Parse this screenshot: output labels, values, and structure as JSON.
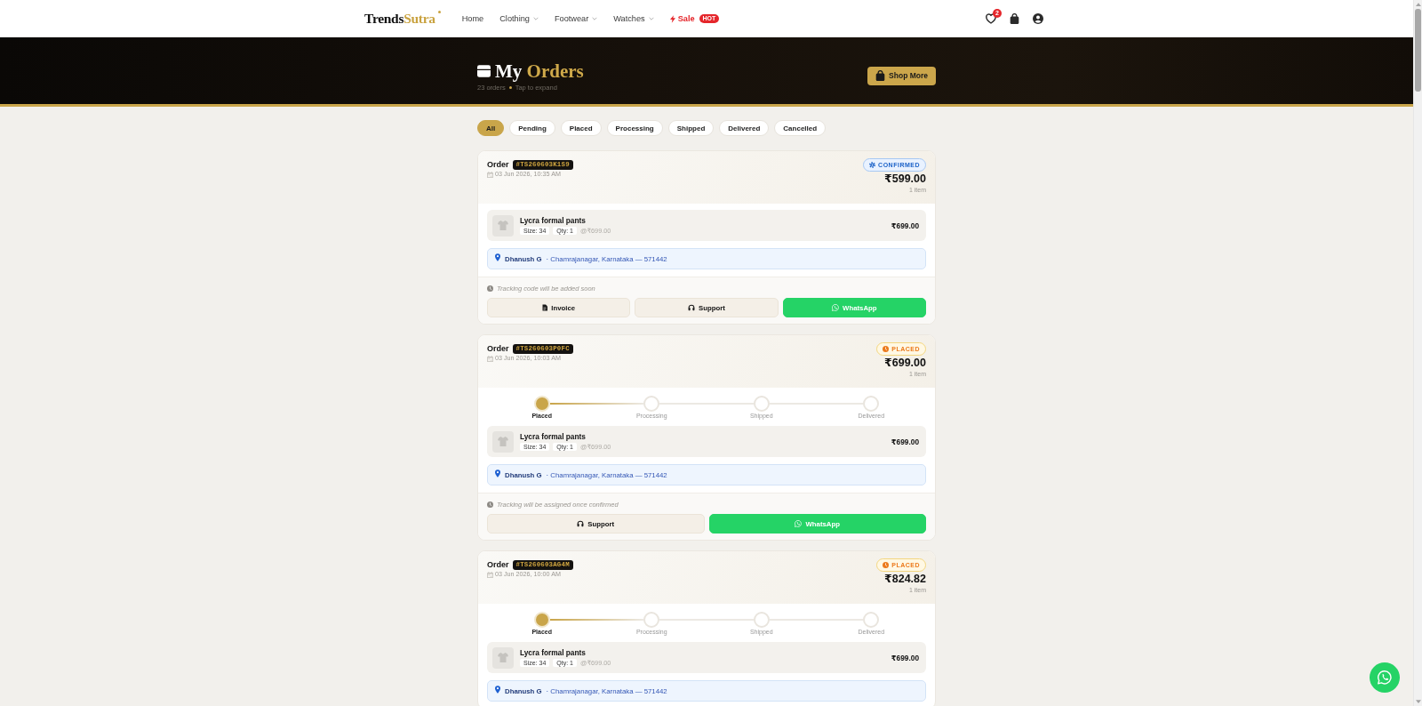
{
  "nav": {
    "brand": {
      "lead": "Trends",
      "accent": "Sutra"
    },
    "links": [
      {
        "label": "Home",
        "kind": "link",
        "dropdown": false
      },
      {
        "label": "Clothing",
        "kind": "link",
        "dropdown": true
      },
      {
        "label": "Footwear",
        "kind": "link",
        "dropdown": true
      },
      {
        "label": "Watches",
        "kind": "link",
        "dropdown": true
      },
      {
        "label": "Sale",
        "kind": "sale",
        "dropdown": false,
        "badge": "HOT"
      }
    ],
    "wishlist_count": "2"
  },
  "header": {
    "title": {
      "lead": "My",
      "accent": "Orders"
    },
    "order_count": "23 orders",
    "hint": "Tap to expand",
    "button": "Shop More"
  },
  "filters": [
    {
      "label": "All",
      "selected": true
    },
    {
      "label": "Pending",
      "selected": false
    },
    {
      "label": "Placed",
      "selected": false
    },
    {
      "label": "Processing",
      "selected": false
    },
    {
      "label": "Shipped",
      "selected": false
    },
    {
      "label": "Delivered",
      "selected": false
    },
    {
      "label": "Cancelled",
      "selected": false
    }
  ],
  "orders": [
    {
      "label": "Order",
      "id": "#TS260603K1S9",
      "date": "03 Jun 2026, 10:35 AM",
      "status": {
        "kind": "confirmed",
        "label": "CONFIRMED"
      },
      "total": "₹599.00",
      "item_count": "1 item",
      "items": [
        {
          "name": "Lycra formal pants",
          "size": "Size: 34",
          "qty": "Qty: 1",
          "unit_price": "@₹699.00",
          "price": "₹699.00"
        }
      ],
      "address": {
        "name": "Dhanush G",
        "location": "· Chamrajanagar, Karnataka — 571442"
      },
      "tracking": "Tracking code will be added soon",
      "actions": [
        {
          "kind": "invoice",
          "label": "Invoice"
        },
        {
          "kind": "support",
          "label": "Support"
        },
        {
          "kind": "whatsapp",
          "label": "WhatsApp"
        }
      ]
    },
    {
      "label": "Order",
      "id": "#TS260603P0FC",
      "date": "03 Jun 2026, 10:03 AM",
      "status": {
        "kind": "placed",
        "label": "PLACED"
      },
      "total": "₹699.00",
      "item_count": "1 item",
      "steps": [
        {
          "label": "Placed",
          "done": true
        },
        {
          "label": "Processing",
          "done": false
        },
        {
          "label": "Shipped",
          "done": false
        },
        {
          "label": "Delivered",
          "done": false
        }
      ],
      "items": [
        {
          "name": "Lycra formal pants",
          "size": "Size: 34",
          "qty": "Qty: 1",
          "unit_price": "@₹699.00",
          "price": "₹699.00"
        }
      ],
      "address": {
        "name": "Dhanush G",
        "location": "· Chamrajanagar, Karnataka — 571442"
      },
      "tracking": "Tracking will be assigned once confirmed",
      "actions": [
        {
          "kind": "support",
          "label": "Support"
        },
        {
          "kind": "whatsapp",
          "label": "WhatsApp"
        }
      ]
    },
    {
      "label": "Order",
      "id": "#TS260603AG4M",
      "date": "03 Jun 2026, 10:00 AM",
      "status": {
        "kind": "placed",
        "label": "PLACED"
      },
      "total": "₹824.82",
      "item_count": "1 item",
      "steps": [
        {
          "label": "Placed",
          "done": true
        },
        {
          "label": "Processing",
          "done": false
        },
        {
          "label": "Shipped",
          "done": false
        },
        {
          "label": "Delivered",
          "done": false
        }
      ],
      "items": [
        {
          "name": "Lycra formal pants",
          "size": "Size: 34",
          "qty": "Qty: 1",
          "unit_price": "@₹699.00",
          "price": "₹699.00"
        }
      ],
      "address": {
        "name": "Dhanush G",
        "location": "· Chamrajanagar, Karnataka — 571442"
      }
    }
  ]
}
